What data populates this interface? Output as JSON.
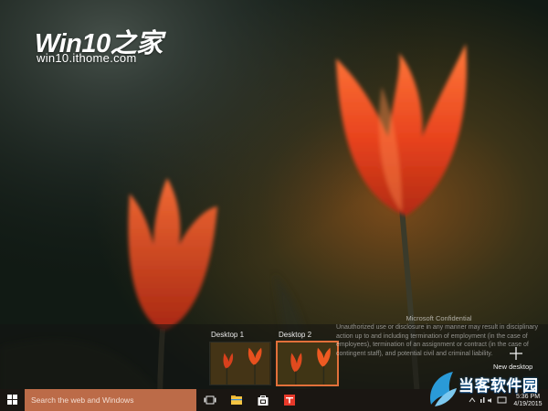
{
  "watermark": {
    "title": "Win10之家",
    "subtitle": "win10.ithome.com"
  },
  "task_view": {
    "desktops": [
      {
        "label": "Desktop 1",
        "active": false
      },
      {
        "label": "Desktop 2",
        "active": true
      }
    ],
    "new_desktop_label": "New desktop",
    "confidential": {
      "title": "Microsoft Confidential",
      "body": "Unauthorized use or disclosure in any manner may result in disciplinary action up to and including termination of employment (in the case of employees), termination of an assignment or contract (in the case of contingent staff), and potential civil and criminal liability."
    }
  },
  "taskbar": {
    "search_placeholder": "Search the web and Windows",
    "pinned": [
      "task-view-icon",
      "file-explorer-icon",
      "store-icon",
      "app-icon"
    ],
    "clock": {
      "time": "5:36 PM",
      "date": "4/19/2015"
    }
  },
  "corner_logo": {
    "text": "当客软件园"
  },
  "colors": {
    "accent": "#e2703a",
    "search_bg": "#bc6b48",
    "taskbar_bg": "#1a1612"
  }
}
